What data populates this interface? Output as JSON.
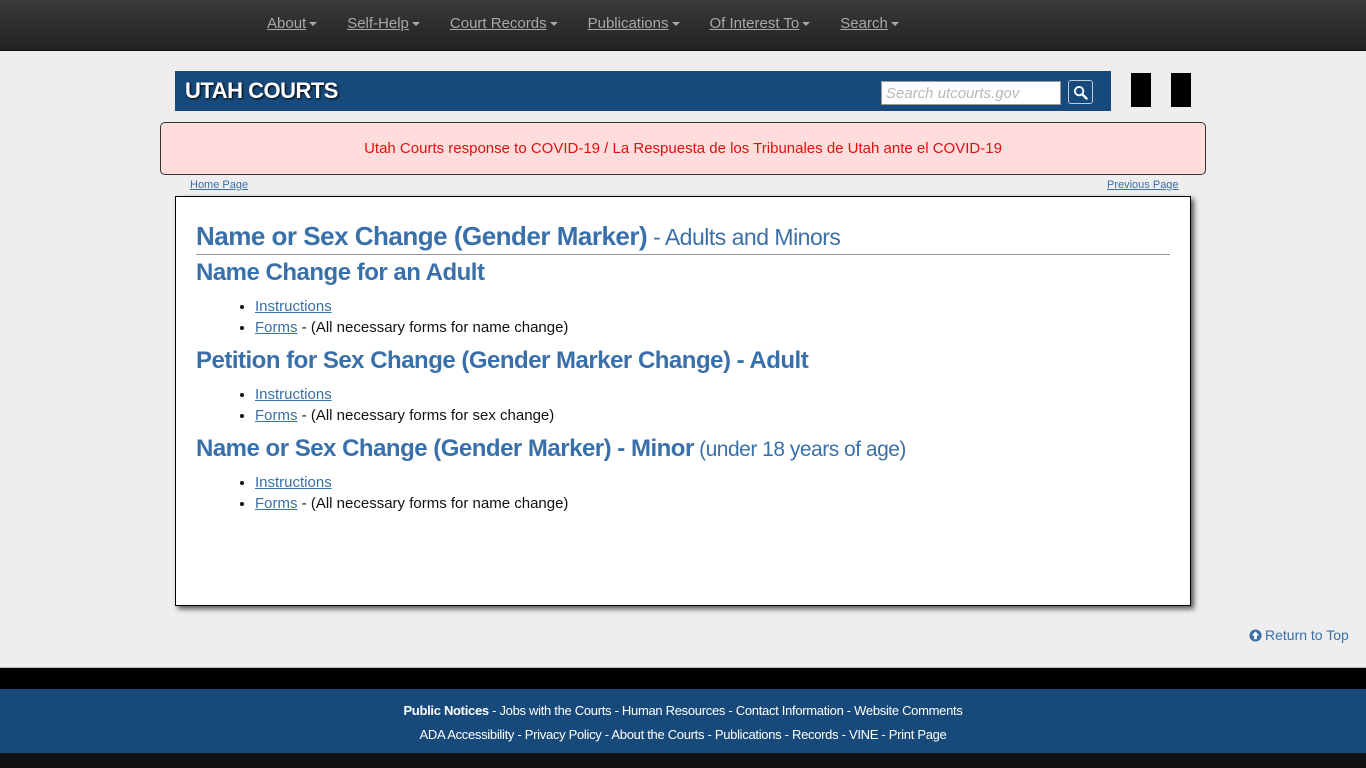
{
  "topnav": {
    "items": [
      {
        "label": "About"
      },
      {
        "label": "Self-Help"
      },
      {
        "label": "Court Records"
      },
      {
        "label": "Publications"
      },
      {
        "label": "Of Interest To"
      },
      {
        "label": "Search"
      }
    ]
  },
  "banner": {
    "title": "UTAH COURTS",
    "search_placeholder": "Search utcourts.gov",
    "search_value": ""
  },
  "alert": {
    "text": "Utah Courts response to COVID-19 / La Respuesta de los Tribunales de Utah ante el COVID-19",
    "color": "#e01010"
  },
  "breadcrumbs": {
    "home": "Home Page",
    "previous": "Previous Page"
  },
  "main": {
    "title": "Name or Sex Change (Gender Marker)",
    "title_sub": " - Adults and Minors",
    "sections": [
      {
        "heading": "Name Change for an Adult",
        "heading_sub": "",
        "links": [
          {
            "label": "Instructions",
            "note": ""
          },
          {
            "label": "Forms",
            "note": " - (All necessary forms for name change)"
          }
        ]
      },
      {
        "heading": "Petition for Sex Change (Gender Marker Change) - Adult",
        "heading_sub": "",
        "links": [
          {
            "label": "Instructions",
            "note": ""
          },
          {
            "label": "Forms",
            "note": " - (All necessary forms for sex change)"
          }
        ]
      },
      {
        "heading": "Name or Sex Change (Gender Marker) - Minor",
        "heading_sub": " (under 18 years of age)",
        "links": [
          {
            "label": "Instructions",
            "note": ""
          },
          {
            "label": "Forms",
            "note": " - (All necessary forms for name change)"
          }
        ]
      }
    ]
  },
  "return_to_top": "Return to Top",
  "footer": {
    "row1": [
      "Public Notices",
      "Jobs with the Courts",
      "Human Resources",
      "Contact Information",
      "Website Comments"
    ],
    "row2": [
      "ADA Accessibility",
      "Privacy Policy",
      "About the Courts",
      "Publications",
      "Records",
      "VINE",
      "Print Page"
    ],
    "separator": " - "
  }
}
